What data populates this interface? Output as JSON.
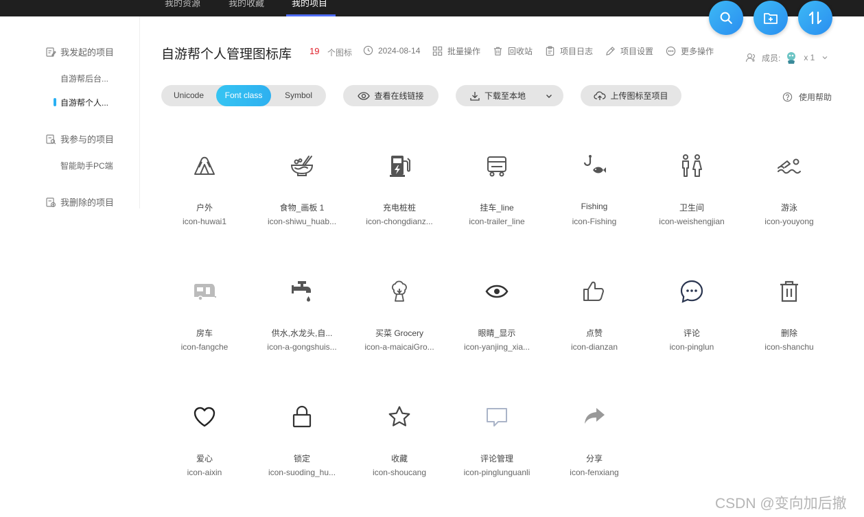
{
  "topnav": {
    "tabs": [
      "我的资源",
      "我的收藏",
      "我的项目"
    ],
    "active_tab": "我的项目"
  },
  "fabs": [
    {
      "icon": "search-icon"
    },
    {
      "icon": "new-project-icon"
    },
    {
      "icon": "sort-icon"
    }
  ],
  "sidebar": {
    "sections": [
      {
        "label": "我发起的项目",
        "icon": "edit-doc-icon"
      },
      {
        "label": "我参与的项目",
        "icon": "search-doc-icon"
      },
      {
        "label": "我删除的项目",
        "icon": "delete-doc-icon"
      }
    ],
    "items": [
      {
        "label": "自游帮后台..."
      },
      {
        "label": "自游帮个人...",
        "active": true
      },
      {
        "label": "智能助手PC端"
      }
    ]
  },
  "header": {
    "title": "自游帮个人管理图标库",
    "icon_count": "19",
    "icon_count_label": "个图标",
    "date": "2024-08-14",
    "actions": [
      "批量操作",
      "回收站",
      "项目日志",
      "项目设置",
      "更多操作"
    ],
    "members_label": "成员:",
    "members_count": "x 1"
  },
  "toolbar": {
    "segments": [
      "Unicode",
      "Font class",
      "Symbol"
    ],
    "active_segment": "Font class",
    "view_link": "查看在线链接",
    "download": "下载至本地",
    "upload": "上传图标至项目",
    "help": "使用帮助"
  },
  "icons": [
    {
      "name": "户外",
      "code": "icon-huwai1",
      "glyph": "tent-icon",
      "color": "#555555"
    },
    {
      "name": "食物_画板 1",
      "code": "icon-shiwu_huab...",
      "glyph": "noodle-bowl-icon",
      "color": "#555555"
    },
    {
      "name": "充电桩桩",
      "code": "icon-chongdianz...",
      "glyph": "charging-station-icon",
      "color": "#555555"
    },
    {
      "name": "挂车_line",
      "code": "icon-trailer_line",
      "glyph": "trailer-icon",
      "color": "#555555"
    },
    {
      "name": "Fishing",
      "code": "icon-Fishing",
      "glyph": "fishing-icon",
      "color": "#555555"
    },
    {
      "name": "卫生间",
      "code": "icon-weishengjian",
      "glyph": "restroom-icon",
      "color": "#555555"
    },
    {
      "name": "游泳",
      "code": "icon-youyong",
      "glyph": "swimming-icon",
      "color": "#555555"
    },
    {
      "name": "房车",
      "code": "icon-fangche",
      "glyph": "caravan-icon",
      "color": "#bbbbbb"
    },
    {
      "name": "供水,水龙头,自...",
      "code": "icon-a-gongshuis...",
      "glyph": "faucet-icon",
      "color": "#555555"
    },
    {
      "name": "买菜 Grocery",
      "code": "icon-a-maicaiGro...",
      "glyph": "grocery-icon",
      "color": "#555555"
    },
    {
      "name": "眼睛_显示",
      "code": "icon-yanjing_xia...",
      "glyph": "eye-icon",
      "color": "#333333"
    },
    {
      "name": "点赞",
      "code": "icon-dianzan",
      "glyph": "thumbs-up-icon",
      "color": "#555555"
    },
    {
      "name": "评论",
      "code": "icon-pinglun",
      "glyph": "comment-icon",
      "color": "#2a3550"
    },
    {
      "name": "删除",
      "code": "icon-shanchu",
      "glyph": "trash-icon",
      "color": "#555555"
    },
    {
      "name": "爱心",
      "code": "icon-aixin",
      "glyph": "heart-icon",
      "color": "#222222"
    },
    {
      "name": "锁定",
      "code": "icon-suoding_hu...",
      "glyph": "lock-icon",
      "color": "#333333"
    },
    {
      "name": "收藏",
      "code": "icon-shoucang",
      "glyph": "star-icon",
      "color": "#444444"
    },
    {
      "name": "评论管理",
      "code": "icon-pinglunguanli",
      "glyph": "comment-manage-icon",
      "color": "#aab4c8"
    },
    {
      "name": "分享",
      "code": "icon-fenxiang",
      "glyph": "share-icon",
      "color": "#999999"
    }
  ],
  "watermark": "CSDN @变向加后撤"
}
